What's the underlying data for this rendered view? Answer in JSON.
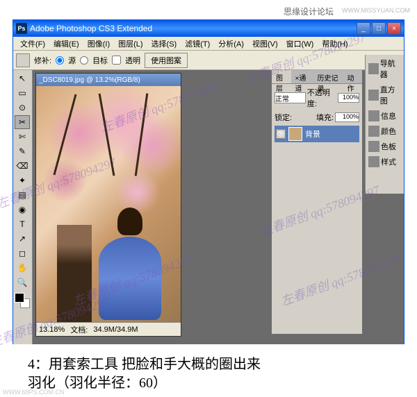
{
  "header": {
    "forum_name": "思缘设计论坛",
    "forum_url": "WWW.MISSYUAN.COM"
  },
  "window": {
    "title": "Adobe Photoshop CS3 Extended",
    "btn_min": "_",
    "btn_max": "□",
    "btn_close": "×"
  },
  "menu": {
    "items": [
      "文件(F)",
      "编辑(E)",
      "图像(I)",
      "图层(L)",
      "选择(S)",
      "滤镜(T)",
      "分析(A)",
      "视图(V)",
      "窗口(W)",
      "帮助(H)"
    ]
  },
  "options": {
    "label_repair": "修补:",
    "radio_src": "源",
    "radio_dest": "目标",
    "check_transparent": "透明",
    "btn_use_pattern": "使用图案"
  },
  "document": {
    "title": "_DSC8019.jpg @ 13.2%(RGB/8)",
    "zoom": "13.18%",
    "doc_size_label": "文档:",
    "doc_size": "34.9M/34.9M"
  },
  "layers_panel": {
    "tabs": [
      "图层",
      "×通道",
      "历史记录",
      "动作"
    ],
    "blend_mode": "正常",
    "opacity_label": "不透明度:",
    "opacity_value": "100%",
    "lock_label": "锁定:",
    "fill_label": "填充:",
    "fill_value": "100%",
    "layer_name": "背景",
    "eye_icon": "👁"
  },
  "right_dock": {
    "items": [
      "导航器",
      "直方图",
      "信息",
      "颜色",
      "色板",
      "样式"
    ]
  },
  "tools": {
    "list": [
      "↖",
      "▭",
      "⊙",
      "✂",
      "✄",
      "✎",
      "⌫",
      "✦",
      "▤",
      "◉",
      "T",
      "↗",
      "◻",
      "✋",
      "🔍"
    ],
    "active_index": 3
  },
  "caption": {
    "line1": "4：用套索工具 把脸和手大概的圈出来",
    "line2": "羽化（羽化半径：60）"
  },
  "watermark": {
    "text": "左春原创 qq:578094297"
  },
  "footer": {
    "url": "WWW.68PS.COM.CN"
  }
}
